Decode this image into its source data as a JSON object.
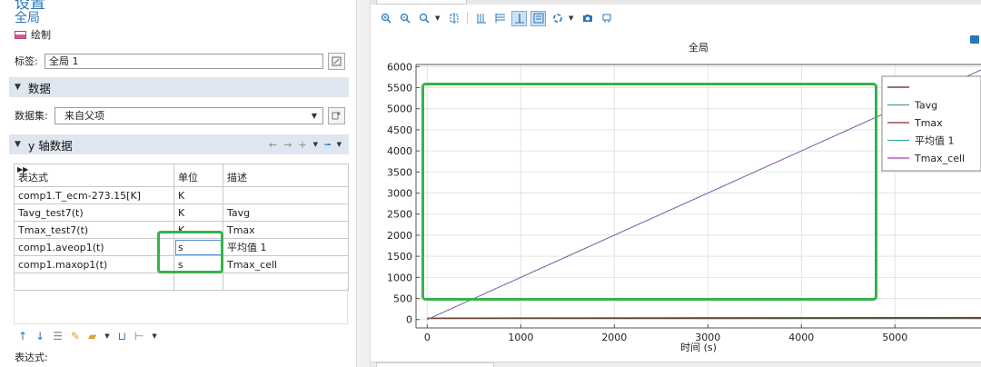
{
  "settings": {
    "title": "设置",
    "subtitle": "全局",
    "plot_button": "绘制",
    "label_caption": "标签:",
    "label_value": "全局 1",
    "data_section": "数据",
    "dataset_caption": "数据集:",
    "dataset_value": "来自父项",
    "y_section": "y 轴数据",
    "table": {
      "headers": [
        "表达式",
        "单位",
        "描述"
      ],
      "rows": [
        [
          "comp1.T_ecm-273.15[K]",
          "K",
          ""
        ],
        [
          "Tavg_test7(t)",
          "K",
          "Tavg"
        ],
        [
          "Tmax_test7(t)",
          "K",
          "Tmax"
        ],
        [
          "comp1.aveop1(t)",
          "s",
          "平均值 1"
        ],
        [
          "comp1.maxop1(t)",
          "s",
          "Tmax_cell"
        ]
      ]
    },
    "expression_caption": "表达式:"
  },
  "icons": {
    "header_arrows": "double-chevron-icon",
    "label_button": "edit-label-icon",
    "dataset_button": "add-dataset-icon",
    "y_tools": [
      "arrow-left-icon",
      "arrow-right-icon",
      "plus-icon",
      "caret-icon",
      "clear-icon"
    ],
    "bottom_tools": [
      "move-up-icon",
      "move-down-icon",
      "list-icon",
      "brush-icon",
      "folder-icon",
      "save-icon",
      "table-add-icon"
    ],
    "toolbar": [
      "zoom-in-icon",
      "zoom-out-icon",
      "zoom-box-icon",
      "zoom-extents-icon",
      "x-axis-icon",
      "y-axis-icon",
      "grid-icon",
      "legend-icon",
      "link-icon",
      "camera-icon",
      "export-icon"
    ]
  },
  "colors": {
    "accent": "#2a78b8",
    "highlight_box": "#35b44a",
    "section_bg": "#dfe6ef"
  },
  "chart_data": {
    "type": "line",
    "title": "全局",
    "xlabel": "时间 (s)",
    "ylabel": "",
    "xlim": [
      -120,
      5920
    ],
    "ylim": [
      -200,
      6050
    ],
    "xticks": [
      0,
      1000,
      2000,
      3000,
      4000,
      5000
    ],
    "yticks": [
      0,
      500,
      1000,
      1500,
      2000,
      2500,
      3000,
      3500,
      4000,
      4500,
      5000,
      5500,
      6000
    ],
    "grid": true,
    "legend_position": "top-right",
    "series": [
      {
        "name": "",
        "color": "#5a1e1e",
        "x": [
          0,
          5920
        ],
        "y": [
          25,
          25
        ]
      },
      {
        "name": "Tavg",
        "color": "#4aa676",
        "x": [
          0,
          5920
        ],
        "y": [
          30,
          42
        ]
      },
      {
        "name": "Tmax",
        "color": "#8a2a2a",
        "x": [
          0,
          5920
        ],
        "y": [
          35,
          50
        ]
      },
      {
        "name": "平均值 1",
        "color": "#38b0a0",
        "x": [
          0,
          5920
        ],
        "y": [
          0,
          5920
        ]
      },
      {
        "name": "Tmax_cell",
        "color": "#b03ab0",
        "x": [
          0,
          5920
        ],
        "y": [
          0,
          5920
        ]
      }
    ]
  }
}
